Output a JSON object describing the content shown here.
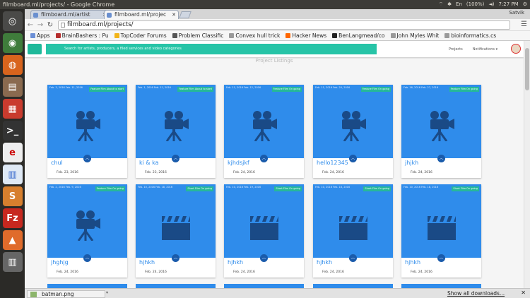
{
  "window": {
    "title": "filmboard.ml/projects/ - Google Chrome",
    "battery": "(100%)",
    "clock": "7:27 PM"
  },
  "tabs": [
    {
      "label": "filmboard.ml/artist"
    },
    {
      "label": "filmboard.ml/projec"
    }
  ],
  "browser": {
    "user": "Satvik",
    "url": "filmboard.ml/projects/"
  },
  "bookmarks": [
    {
      "label": "Apps",
      "color": "#6b8fd6"
    },
    {
      "label": "BrainBashers : Pu",
      "color": "#b52d2d"
    },
    {
      "label": "TopCoder Forums",
      "color": "#f2b418"
    },
    {
      "label": "Problem Classific",
      "color": "#555555"
    },
    {
      "label": "Convex hull trick",
      "color": "#9a9a9a"
    },
    {
      "label": "Hacker News",
      "color": "#ff6600"
    },
    {
      "label": "BenLangmead/co",
      "color": "#222222"
    },
    {
      "label": "John Myles Whit",
      "color": "#9a9a9a"
    },
    {
      "label": "bioinformatics.cs",
      "color": "#9a9a9a"
    }
  ],
  "app": {
    "search_placeholder": "Search for artists, producers, a filed services and video categories",
    "nav": [
      "Projects",
      "Notifications"
    ],
    "heading": "Project Listings"
  },
  "projects": [
    {
      "dates": "Feb. 3, 2016 Feb. 11, 2016",
      "status": "Feature Film About to start",
      "icon": "film-camera-icon",
      "name": "chul",
      "date": "Feb. 23, 2016"
    },
    {
      "dates": "Feb. 1, 2016 Feb. 11, 2016",
      "status": "Feature Film About to start",
      "icon": "film-camera-icon",
      "name": "ki & ka",
      "date": "Feb. 23, 2016"
    },
    {
      "dates": "Feb. 11, 2016 Feb. 12, 2016",
      "status": "Feature Film On going",
      "icon": "film-camera-icon",
      "name": "kjhdsjkf",
      "date": "Feb. 24, 2016"
    },
    {
      "dates": "Feb. 11, 2016 Feb. 20, 2016",
      "status": "Feature Film On going",
      "icon": "film-camera-icon",
      "name": "hello12345",
      "date": "Feb. 24, 2016"
    },
    {
      "dates": "Feb. 16, 2016 Feb. 27, 2016",
      "status": "Feature Film On going",
      "icon": "film-camera-icon",
      "name": "jhjkh",
      "date": "Feb. 24, 2016"
    },
    {
      "dates": "Feb. 2, 2016 Feb. 9, 2016",
      "status": "Feature Film On going",
      "icon": "film-camera-icon",
      "name": "jhghjg",
      "date": "Feb. 24, 2016"
    },
    {
      "dates": "Feb. 10, 2016 Feb. 18, 2016",
      "status": "Short Film On going",
      "icon": "clapperboard-icon",
      "name": "hjhkh",
      "date": "Feb. 24, 2016"
    },
    {
      "dates": "Feb. 10, 2016 Feb. 19, 2016",
      "status": "Short Film On going",
      "icon": "clapperboard-icon",
      "name": "hjhkh",
      "date": "Feb. 24, 2016"
    },
    {
      "dates": "Feb. 10, 2016 Feb. 18, 2016",
      "status": "Short Film On going",
      "icon": "clapperboard-icon",
      "name": "hjhkh",
      "date": "Feb. 24, 2016"
    },
    {
      "dates": "Feb. 10, 2016 Feb. 18, 2016",
      "status": "Short Film On going",
      "icon": "clapperboard-icon",
      "name": "hjhkh",
      "date": "Feb. 24, 2016"
    }
  ],
  "downloads": {
    "file": "batman.png",
    "show_all": "Show all downloads..."
  }
}
